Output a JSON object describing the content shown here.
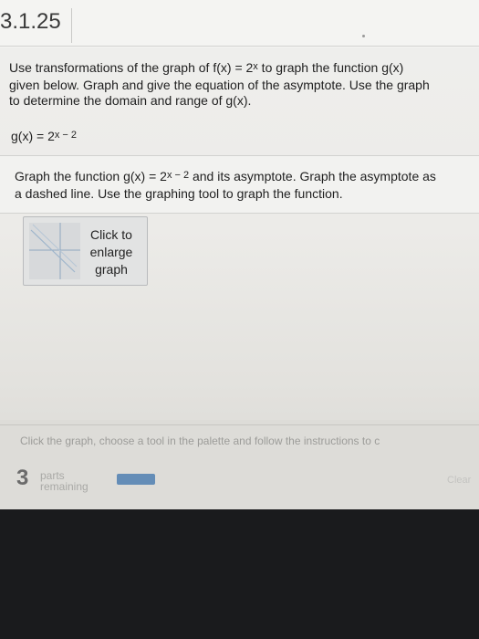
{
  "header": {
    "problem_number": "3.1.25"
  },
  "question": {
    "line1_pre": "Use transformations of the graph of f(x) = 2",
    "line1_exp": "x",
    "line1_post": " to graph the function g(x)",
    "line2": "given below. Graph and give the equation of the asymptote. Use the graph",
    "line3": "to determine the domain and range of g(x)."
  },
  "function_line": {
    "base": "g(x) = 2",
    "exponent": "x − 2"
  },
  "instruction": {
    "pre": "Graph the function g(x) = 2",
    "exponent": "x − 2",
    "post": " and its asymptote. Graph the asymptote as",
    "line2": "a dashed line. Use the graphing tool to graph the function."
  },
  "enlarge_button": {
    "line1": "Click to",
    "line2": "enlarge",
    "line3": "graph"
  },
  "palette": {
    "hint": "Click the graph, choose a tool in the palette and follow the instructions to c",
    "parts_count": "3",
    "parts_line1": "parts",
    "parts_line2": "remaining",
    "progress_fraction": 0.3,
    "clear_label": "Clear"
  },
  "colors": {
    "progress": "#4f7fb2",
    "bezel": "#1a1b1d"
  }
}
